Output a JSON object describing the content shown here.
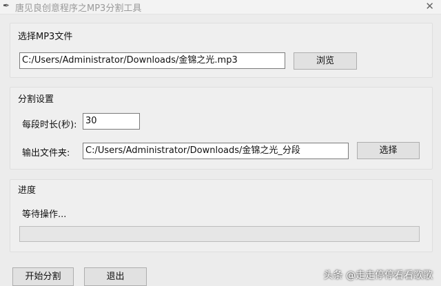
{
  "window": {
    "title": "唐见良创意程序之MP3分割工具",
    "close_glyph": "✕",
    "icon_glyph": "✒"
  },
  "mp3_section": {
    "label": "选择MP3文件",
    "file_path": "C:/Users/Administrator/Downloads/金锦之光.mp3",
    "browse_label": "浏览"
  },
  "split_section": {
    "label": "分割设置",
    "duration_label": "每段时长(秒):",
    "duration_value": "30",
    "output_label": "输出文件夹:",
    "output_path": "C:/Users/Administrator/Downloads/金锦之光_分段",
    "choose_label": "选择"
  },
  "progress_section": {
    "label": "进度",
    "status_text": "等待操作...",
    "progress_fraction": 0
  },
  "actions": {
    "start_label": "开始分割",
    "exit_label": "退出"
  },
  "watermark": {
    "text": "头条 @走走停停看看歌歌"
  }
}
